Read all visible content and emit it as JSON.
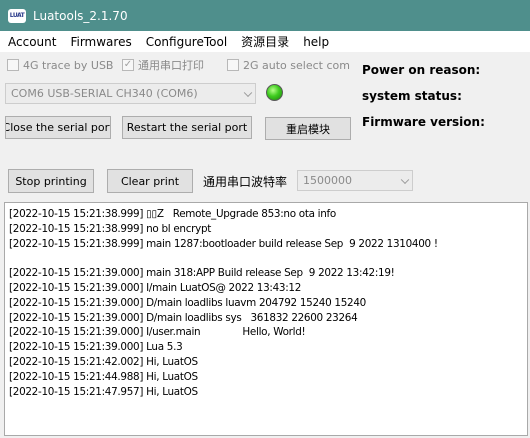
{
  "window": {
    "app_icon_text": "LUAT",
    "title": "Luatools_2.1.70"
  },
  "menu": [
    "Account",
    "Firmwares",
    "ConfigureTool",
    "资源目录",
    "help"
  ],
  "checkboxes": [
    {
      "label": "4G trace by USB",
      "checked": false
    },
    {
      "label": "通用串口打印",
      "checked": true
    },
    {
      "label": "2G auto select com",
      "checked": false
    }
  ],
  "port": {
    "selected": "COM6 USB-SERIAL CH340 (COM6)"
  },
  "status_led": {
    "color": "#3fcc1f",
    "state": "connected"
  },
  "buttons": {
    "close_serial": "Close the serial port",
    "restart_serial": "Restart the serial port",
    "reboot_module": "重启模块",
    "stop_printing": "Stop printing",
    "clear_print": "Clear print"
  },
  "baud": {
    "label": "通用串口波特率",
    "value": "1500000"
  },
  "info": {
    "power_on_reason": "Power on reason:",
    "system_status": "system status:",
    "firmware_version": "Firmware version:"
  },
  "log_lines": [
    "[2022-10-15 15:21:38.999] ▯▯Z   Remote_Upgrade 853:no ota info",
    "[2022-10-15 15:21:38.999] no bl encrypt",
    "[2022-10-15 15:21:38.999] main 1287:bootloader build release Sep  9 2022 1310400 !",
    "",
    "[2022-10-15 15:21:39.000] main 318:APP Build release Sep  9 2022 13:42:19!",
    "[2022-10-15 15:21:39.000] I/main LuatOS@ 2022 13:43:12",
    "[2022-10-15 15:21:39.000] D/main loadlibs luavm 204792 15240 15240",
    "[2022-10-15 15:21:39.000] D/main loadlibs sys   361832 22600 23264",
    "[2022-10-15 15:21:39.000] I/user.main              Hello, World!",
    "[2022-10-15 15:21:39.000] Lua 5.3",
    "[2022-10-15 15:21:42.002] Hi, LuatOS",
    "[2022-10-15 15:21:44.988] Hi, LuatOS",
    "[2022-10-15 15:21:47.957] Hi, LuatOS"
  ]
}
